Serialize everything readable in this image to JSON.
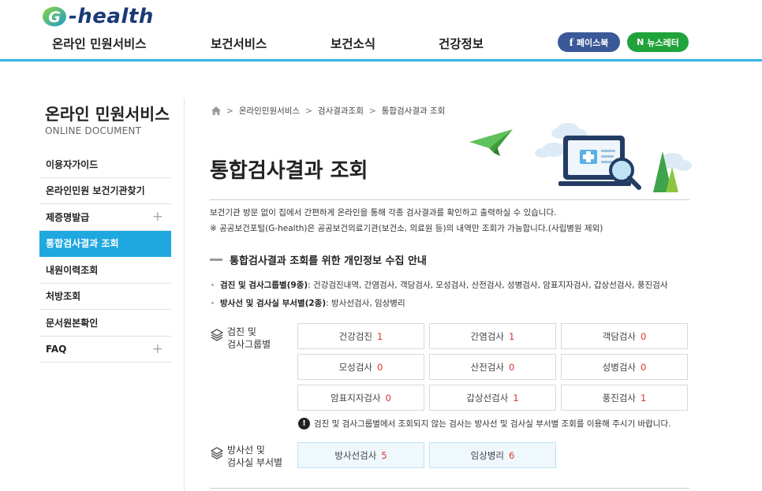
{
  "logo": {
    "text": "-health"
  },
  "gnb": [
    "온라인 민원서비스",
    "보건서비스",
    "보건소식",
    "건강정보"
  ],
  "sns": {
    "facebook": "페이스북",
    "facebook_icon": "f",
    "newsletter": "뉴스레터",
    "newsletter_icon": "N"
  },
  "sidebar": {
    "title": "온라인 민원서비스",
    "subtitle": "ONLINE DOCUMENT",
    "items": [
      {
        "label": "이용자가이드"
      },
      {
        "label": "온라인민원 보건기관찾기"
      },
      {
        "label": "제증명발급",
        "expand": "+"
      },
      {
        "label": "통합검사결과 조회"
      },
      {
        "label": "내원이력조회"
      },
      {
        "label": "처방조회"
      },
      {
        "label": "문서원본확인"
      },
      {
        "label": "FAQ",
        "expand": "+"
      }
    ]
  },
  "breadcrumb": [
    "온라인민원서비스",
    "검사결과조회",
    "통합검사결과 조회"
  ],
  "breadcrumb_sep": ">",
  "page_title": "통합검사결과 조회",
  "desc": [
    "보건기관 방문 없이 집에서 간편하게 온라인을 통해 각종 검사결과를 확인하고 출력하실 수 있습니다.",
    "※ 공공보건포털(G-health)은 공공보건의료기관(보건소, 의료원 등)의 내역만 조회가 가능합니다.(사립병원 제외)"
  ],
  "section_title": "통합검사결과 조회를 위한 개인정보 수집 안내",
  "bullets": [
    {
      "bold": "검진 및 검사그룹별(9종)",
      "text": " : 건강검진내역, 간염검사, 객담검사, 모성검사, 산전검사, 성병검사, 암표지자검사, 갑상선검사, 풍진검사"
    },
    {
      "bold": "방사선 및 검사실 부서별(2종)",
      "text": " : 방사선검사, 임상병리"
    }
  ],
  "group1": {
    "label_line1": "검진 및",
    "label_line2": "검사그룹별",
    "cells": [
      {
        "label": "건강검진",
        "count": "1"
      },
      {
        "label": "간염검사",
        "count": "1"
      },
      {
        "label": "객담검사",
        "count": "0"
      },
      {
        "label": "모성검사",
        "count": "0"
      },
      {
        "label": "산전검사",
        "count": "0"
      },
      {
        "label": "성병검사",
        "count": "0"
      },
      {
        "label": "암표지자검사",
        "count": "0"
      },
      {
        "label": "갑상선검사",
        "count": "1"
      },
      {
        "label": "풍진검사",
        "count": "1"
      }
    ]
  },
  "notice": {
    "icon": "!",
    "text": "검진 및 검사그룹별에서 조회되지 않는 검사는 방사선 및 검사실 부서별 조회를 이용해 주시기 바랍니다."
  },
  "group2": {
    "label_line1": "방사선 및",
    "label_line2": "검사실 부서별",
    "cells": [
      {
        "label": "방사선검사",
        "count": "5"
      },
      {
        "label": "임상병리",
        "count": "6"
      }
    ]
  },
  "colors": {
    "accent": "#1fa8e0",
    "header_line": "#33b5e5",
    "count": "#e0312b",
    "facebook": "#3b5998",
    "newsletter": "#1fa33a"
  }
}
